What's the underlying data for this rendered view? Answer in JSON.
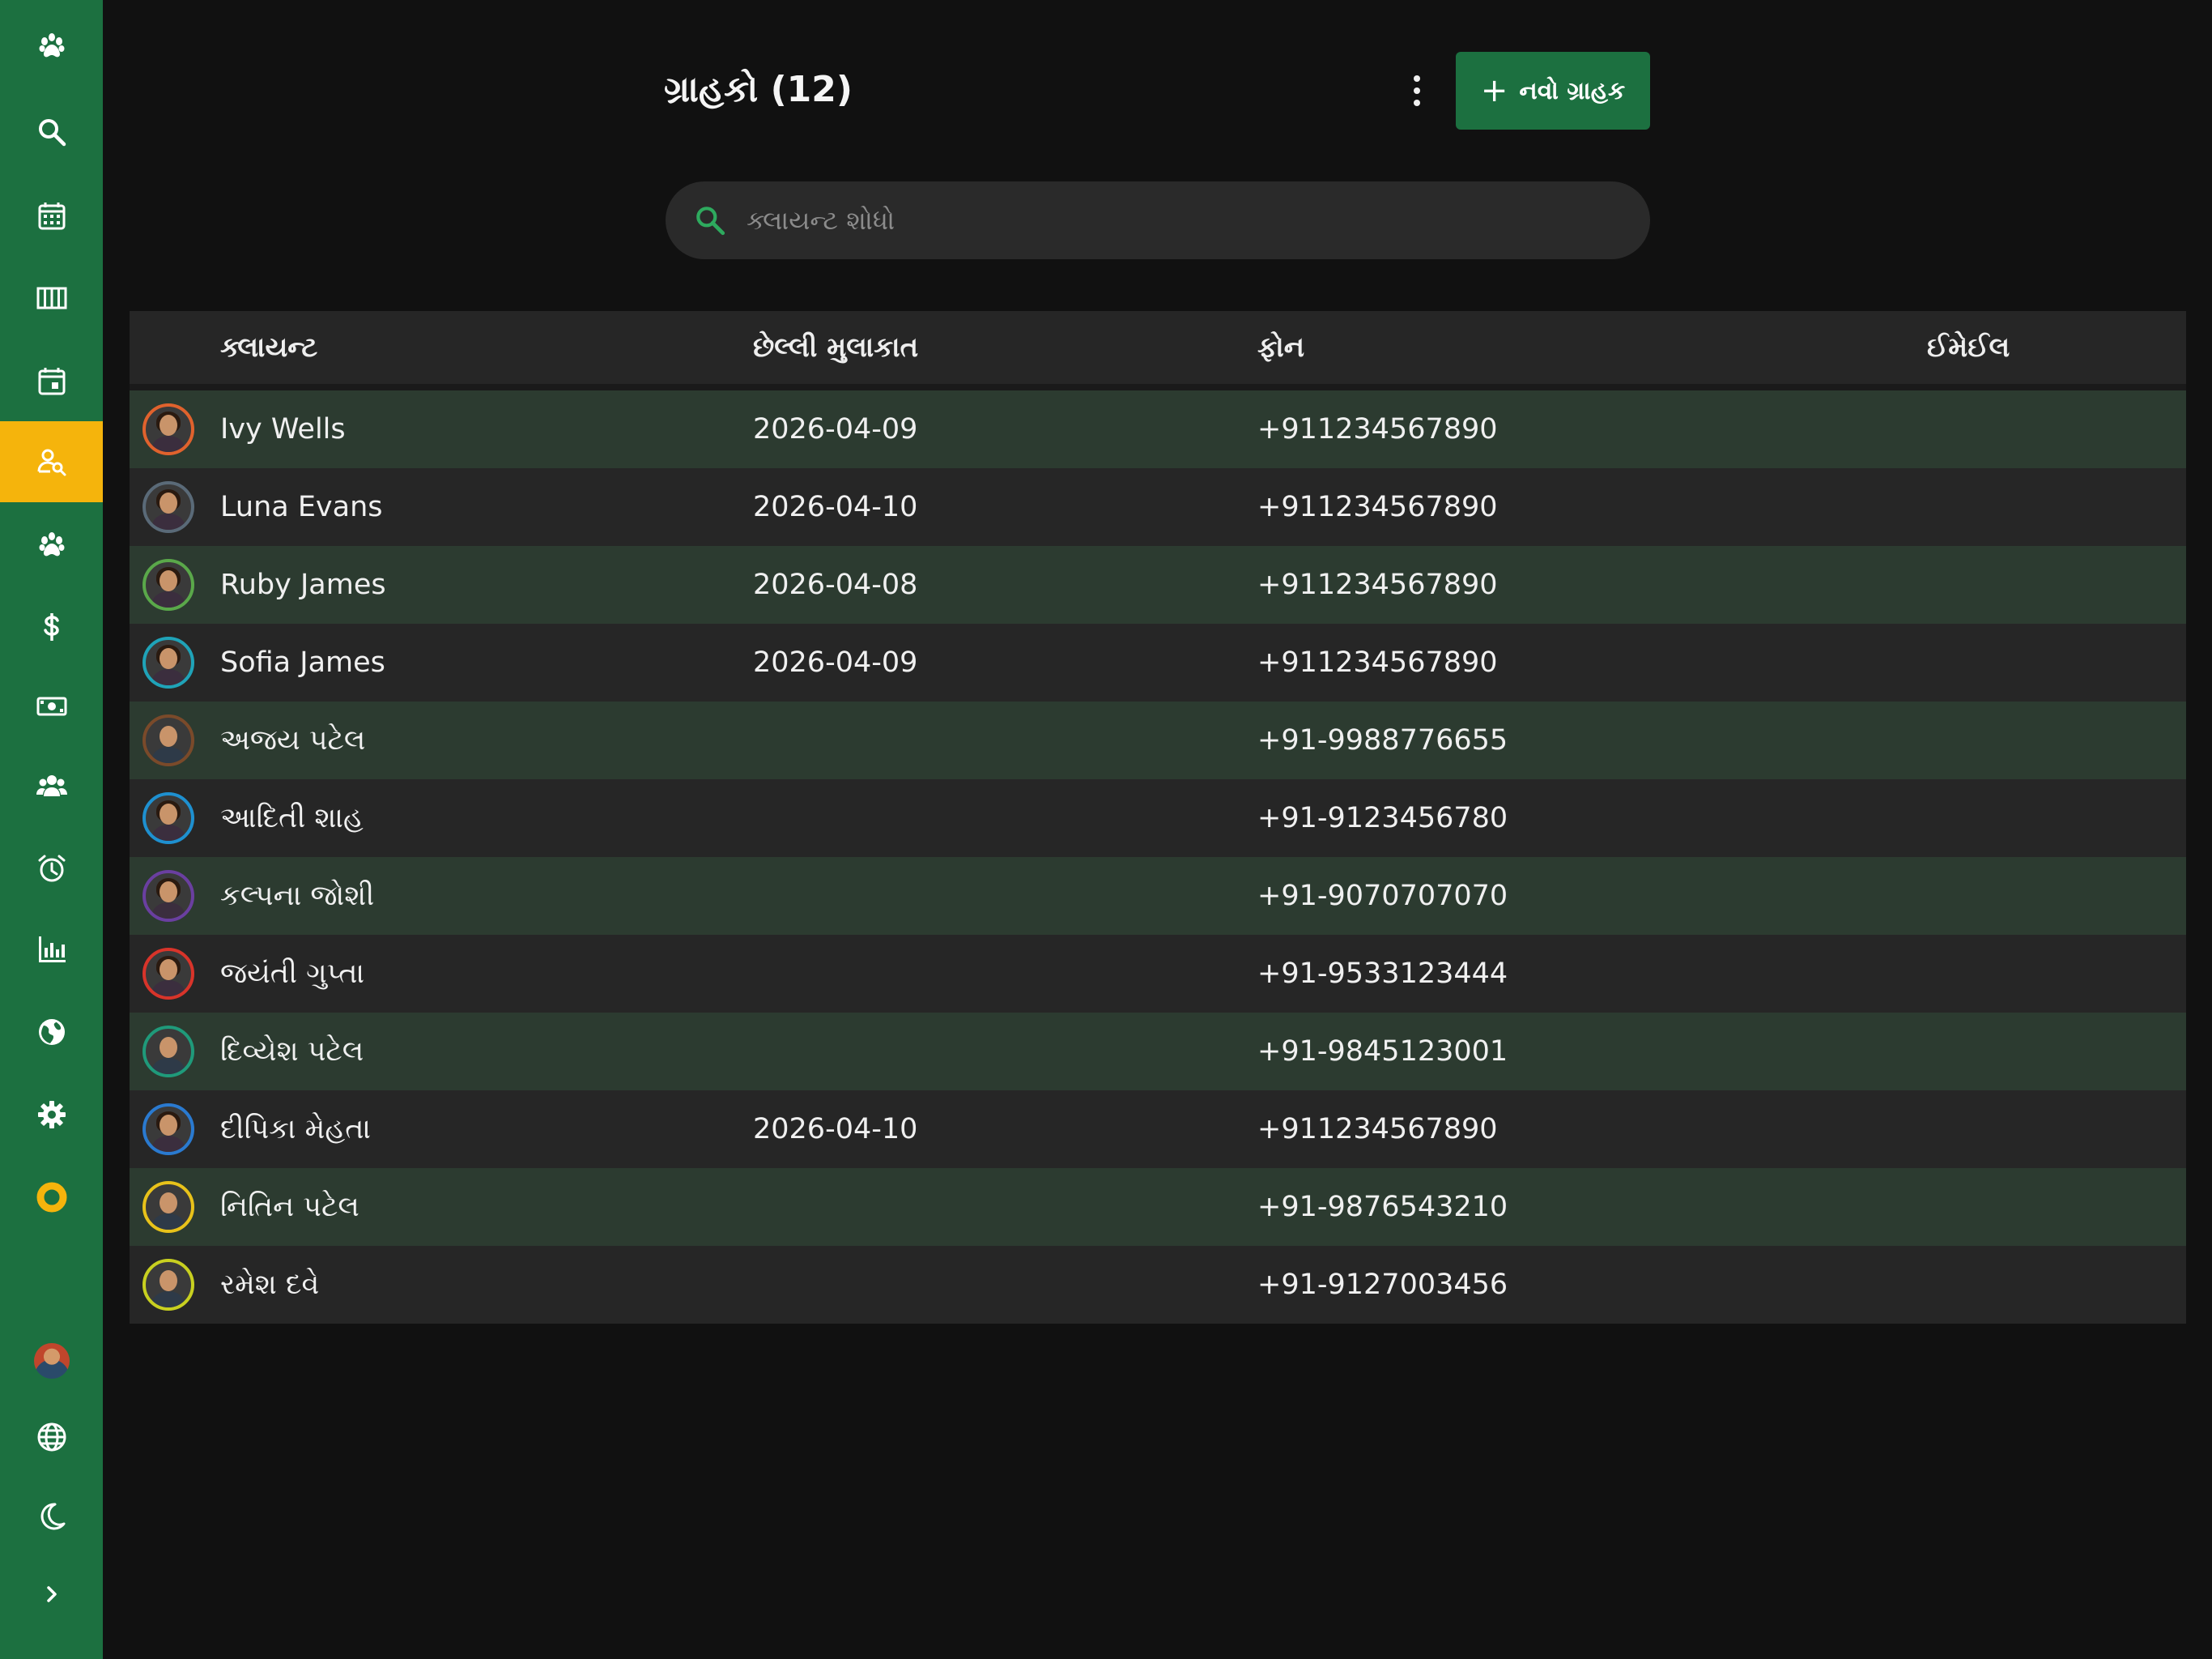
{
  "colors": {
    "sidebar": "#1c7040",
    "active": "#f5b40c",
    "background": "#111111",
    "row_even": "#2c3b30",
    "row_odd": "#262626"
  },
  "sidebar": {
    "items": [
      {
        "icon": "paw-icon"
      },
      {
        "icon": "search-icon"
      },
      {
        "icon": "calendar-icon"
      },
      {
        "icon": "columns-icon"
      },
      {
        "icon": "calendar-day-icon"
      },
      {
        "icon": "client-search-icon",
        "active": true
      },
      {
        "icon": "paw-icon"
      },
      {
        "icon": "dollar-icon"
      },
      {
        "icon": "cash-icon"
      },
      {
        "icon": "group-icon"
      },
      {
        "icon": "alarm-icon"
      },
      {
        "icon": "bar-chart-icon"
      },
      {
        "icon": "globe-americas-icon"
      },
      {
        "icon": "gear-icon"
      },
      {
        "icon": "ring-icon"
      }
    ],
    "bottom": [
      {
        "icon": "user-avatar"
      },
      {
        "icon": "language-globe-icon"
      },
      {
        "icon": "moon-icon"
      },
      {
        "icon": "chevron-right-icon"
      }
    ]
  },
  "header": {
    "title": "ગ્રાહકો (12)",
    "new_button_label": "નવો ગ્રાહક"
  },
  "search": {
    "placeholder": "ક્લાયન્ટ શોધો"
  },
  "table": {
    "headers": {
      "client": "ક્લાયન્ટ",
      "last_visit": "છેલ્લી મુલાકાત",
      "phone": "ફોન",
      "email": "ઈમેઈલ"
    },
    "rows": [
      {
        "name": "Ivy Wells",
        "last_visit": "2026-04-09",
        "phone": "+911234567890",
        "email": "",
        "ring": "#e0622d",
        "gender": "f"
      },
      {
        "name": "Luna Evans",
        "last_visit": "2026-04-10",
        "phone": "+911234567890",
        "email": "",
        "ring": "#5a6a78",
        "gender": "f"
      },
      {
        "name": "Ruby James",
        "last_visit": "2026-04-08",
        "phone": "+911234567890",
        "email": "",
        "ring": "#5aa84a",
        "gender": "f"
      },
      {
        "name": "Sofia James",
        "last_visit": "2026-04-09",
        "phone": "+911234567890",
        "email": "",
        "ring": "#1fa3b8",
        "gender": "f"
      },
      {
        "name": "અજય પટેલ",
        "last_visit": "",
        "phone": "+91-9988776655",
        "email": "",
        "ring": "#7a4a2a",
        "gender": "m"
      },
      {
        "name": "આદિતી શાહ",
        "last_visit": "",
        "phone": "+91-9123456780",
        "email": "",
        "ring": "#1e90d0",
        "gender": "f"
      },
      {
        "name": "કલ્પના જોશી",
        "last_visit": "",
        "phone": "+91-9070707070",
        "email": "",
        "ring": "#6a3fa0",
        "gender": "f"
      },
      {
        "name": "જયંતી ગુપ્તા",
        "last_visit": "",
        "phone": "+91-9533123444",
        "email": "",
        "ring": "#d8342a",
        "gender": "f"
      },
      {
        "name": "દિવ્યેશ પટેલ",
        "last_visit": "",
        "phone": "+91-9845123001",
        "email": "",
        "ring": "#1f9a7a",
        "gender": "m"
      },
      {
        "name": "દીપિકા મેહતા",
        "last_visit": "2026-04-10",
        "phone": "+911234567890",
        "email": "",
        "ring": "#2a7ad0",
        "gender": "f"
      },
      {
        "name": "નિતિન પટેલ",
        "last_visit": "",
        "phone": "+91-9876543210",
        "email": "",
        "ring": "#e8c21a",
        "gender": "m"
      },
      {
        "name": "રમેશ દવે",
        "last_visit": "",
        "phone": "+91-9127003456",
        "email": "",
        "ring": "#c8d020",
        "gender": "m"
      }
    ]
  }
}
